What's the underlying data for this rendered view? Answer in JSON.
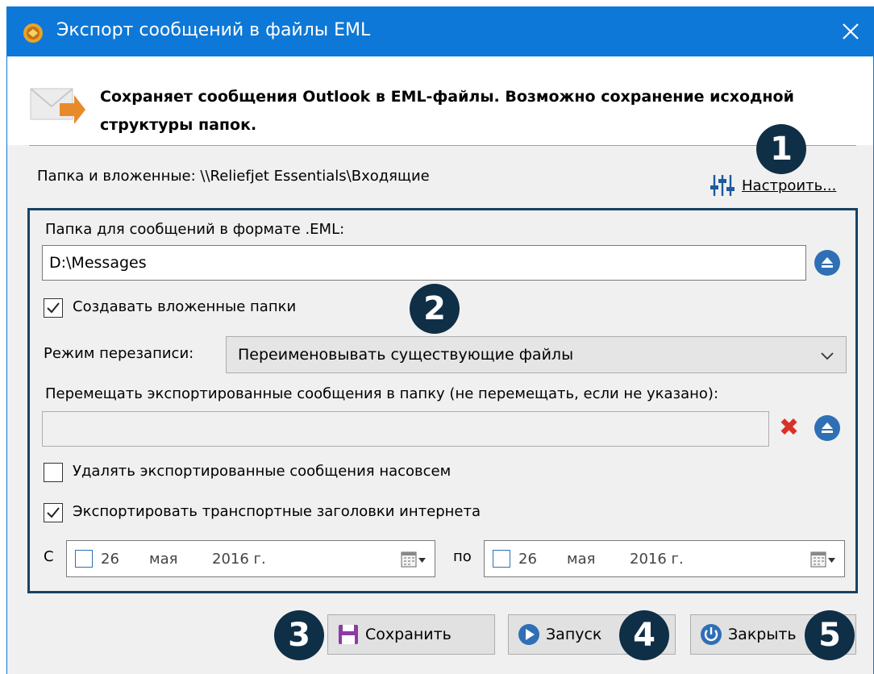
{
  "window": {
    "title": "Экспорт сообщений в файлы EML",
    "accent": "#0d78d7"
  },
  "header": {
    "description": "Сохраняет сообщения Outlook в EML-файлы. Возможно сохранение исходной структуры папок."
  },
  "source": {
    "folder_label": "Папка и вложенные: \\\\Reliefjet Essentials\\Входящие",
    "configure_label": "Настроить..."
  },
  "form": {
    "target_label": "Папка для сообщений в формате .EML:",
    "target_value": "D:\\Messages",
    "create_subfolders_label": "Создавать вложенные папки",
    "create_subfolders_checked": true,
    "overwrite_label": "Режим перезаписи:",
    "overwrite_value": "Переименовывать существующие файлы",
    "move_label": "Перемещать экспортированные сообщения в папку (не перемещать, если не указано):",
    "move_value": "",
    "delete_label": "Удалять экспортированные сообщения насовсем",
    "delete_checked": false,
    "headers_label": "Экспортировать транспортные заголовки интернета",
    "headers_checked": true,
    "from_label": "С",
    "to_label": "по",
    "date_from": {
      "day": "26",
      "month": "мая",
      "year": "2016 г."
    },
    "date_to": {
      "day": "26",
      "month": "мая",
      "year": "2016 г."
    }
  },
  "buttons": {
    "save": "Сохранить",
    "run": "Запуск",
    "close": "Закрыть"
  },
  "badges": [
    "1",
    "2",
    "3",
    "4",
    "5"
  ],
  "icons": {
    "app": "app-logo-icon",
    "envelope": "envelope-arrow-icon",
    "configure": "sliders-icon",
    "browse": "eject-icon",
    "clear": "red-x-icon",
    "calendar": "calendar-icon"
  }
}
